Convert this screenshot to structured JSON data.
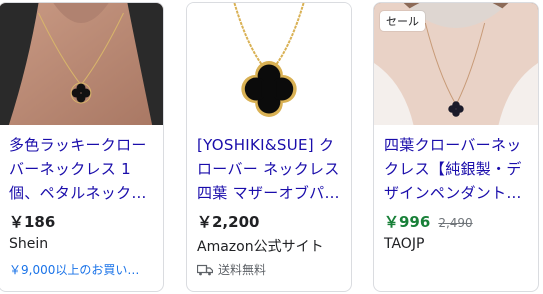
{
  "products": [
    {
      "title": "多色ラッキークローバーネックレス 1個、ペタルネック…",
      "price": "￥186",
      "merchant": "Shein",
      "extra": "￥9,000以上のお買い…"
    },
    {
      "title": "[YOSHIKI&SUE] クローバー ネックレス 四葉 マザーオブパ…",
      "price": "￥2,200",
      "merchant": "Amazon公式サイト",
      "shipping": "送料無料"
    },
    {
      "badge": "セール",
      "title": "四葉クローバーネックレス【純銀製・デザインペンダント…",
      "price": "￥996",
      "old_price": "2,490",
      "merchant": "TAOJP"
    }
  ],
  "colors": {
    "link": "#1a0dab",
    "sale_price": "#188038",
    "extra_link": "#1a73e8"
  }
}
